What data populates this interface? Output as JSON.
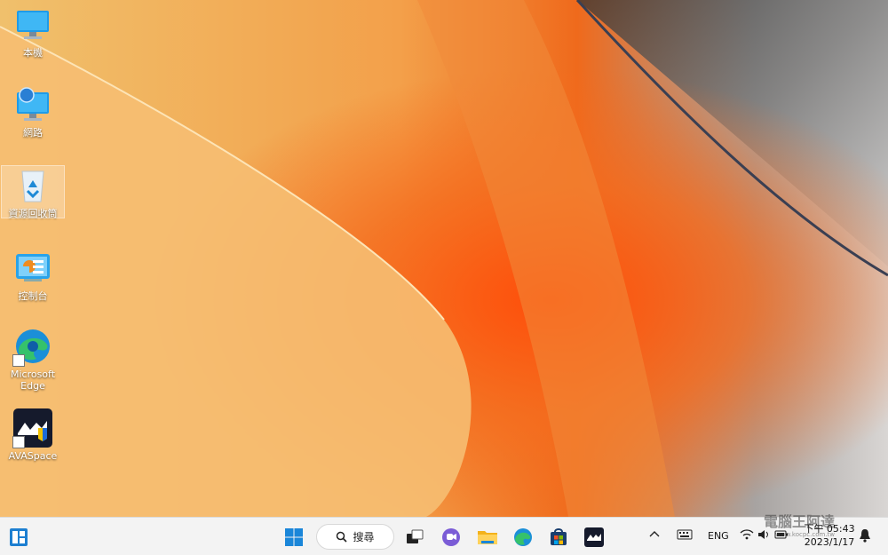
{
  "desktop": {
    "icons": [
      {
        "label": "本機"
      },
      {
        "label": "網路"
      },
      {
        "label": "資源回收筒"
      },
      {
        "label": "控制台"
      },
      {
        "label": "Microsoft Edge"
      },
      {
        "label": "AVASpace"
      }
    ]
  },
  "taskbar": {
    "search_label": "搜尋",
    "apps": [
      "widgets-icon",
      "start-icon",
      "task-view-icon",
      "chat-icon",
      "file-explorer-icon",
      "edge-icon",
      "store-icon",
      "avaspace-icon"
    ],
    "tray": {
      "chevron": "^",
      "language": "ENG",
      "time": "下午 05:43",
      "date": "2023/1/17"
    }
  },
  "watermark": {
    "title": "電腦王阿達",
    "url": "www.kocpc.com.tw"
  },
  "colors": {
    "accent": "#f25a0e",
    "taskbar": "#f3f3f3"
  }
}
